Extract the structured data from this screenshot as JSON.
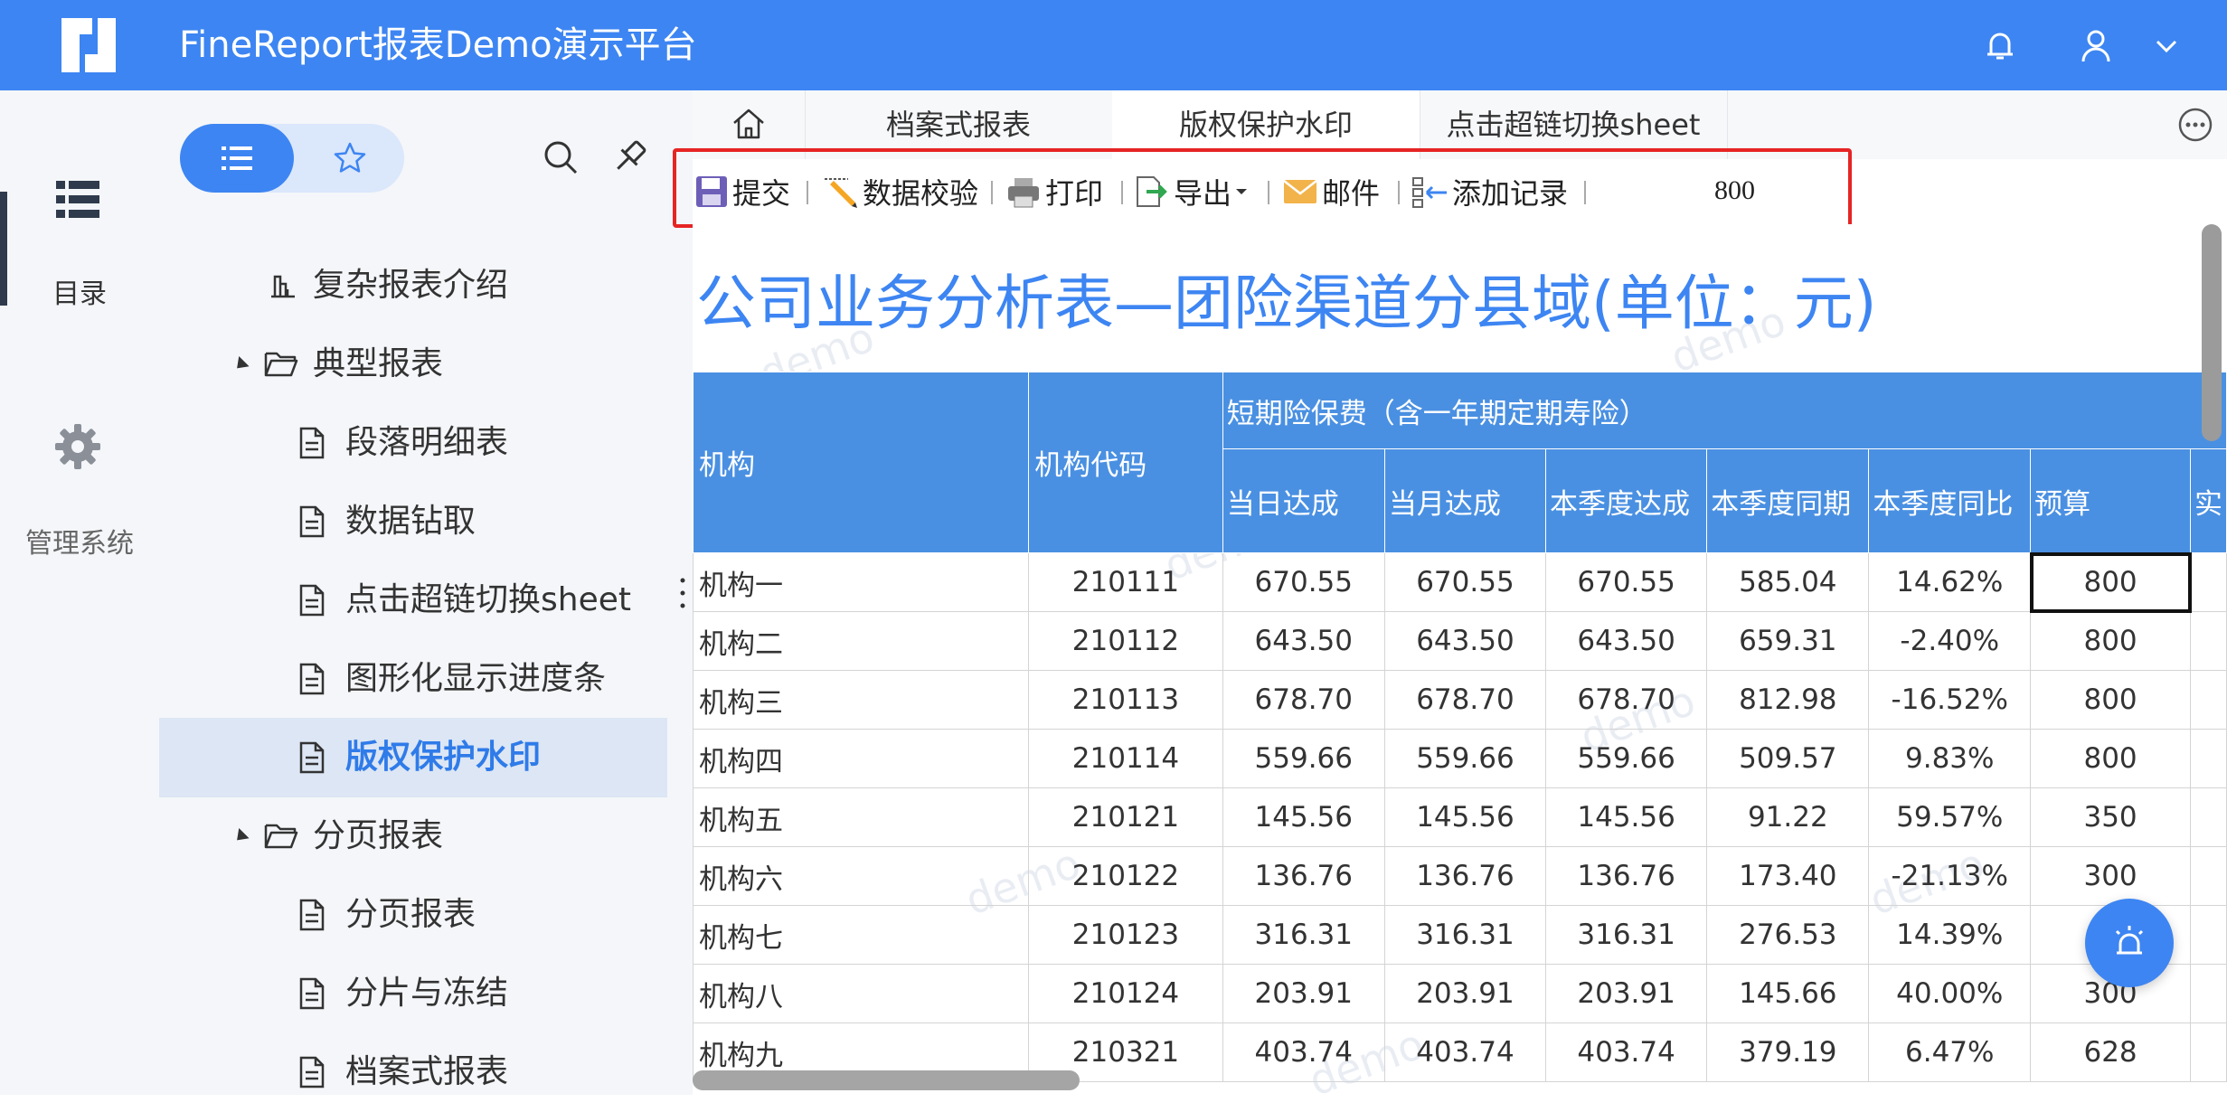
{
  "header": {
    "title": "FineReport报表Demo演示平台"
  },
  "rail": {
    "catalog_label": "目录",
    "admin_label": "管理系统"
  },
  "directory": {
    "items": [
      {
        "label": "复杂报表介绍",
        "level": 0,
        "icon": "chart-icon"
      },
      {
        "label": "典型报表",
        "level": 0,
        "icon": "folder-open-icon",
        "expanded": true
      },
      {
        "label": "段落明细表",
        "level": 1,
        "icon": "document-icon"
      },
      {
        "label": "数据钻取",
        "level": 1,
        "icon": "document-icon"
      },
      {
        "label": "点击超链切换sheet",
        "level": 1,
        "icon": "document-icon"
      },
      {
        "label": "图形化显示进度条",
        "level": 1,
        "icon": "document-icon"
      },
      {
        "label": "版权保护水印",
        "level": 1,
        "icon": "document-icon",
        "selected": true
      },
      {
        "label": "分页报表",
        "level": 0,
        "icon": "folder-open-icon",
        "expanded": true
      },
      {
        "label": "分页报表",
        "level": 1,
        "icon": "document-icon"
      },
      {
        "label": "分片与冻结",
        "level": 1,
        "icon": "document-icon"
      },
      {
        "label": "档案式报表",
        "level": 1,
        "icon": "document-icon"
      }
    ]
  },
  "tabs": [
    {
      "label": "档案式报表"
    },
    {
      "label": "版权保护水印",
      "active": true
    },
    {
      "label": "点击超链切换sheet"
    }
  ],
  "toolbar": {
    "submit": "提交",
    "validate": "数据校验",
    "print": "打印",
    "export": "导出",
    "mail": "邮件",
    "add_record": "添加记录",
    "value": "800"
  },
  "report": {
    "title": "公司业务分析表—团险渠道分县域(单位：元)",
    "watermark": "demo",
    "headers": {
      "org": "机构",
      "code": "机构代码",
      "group": "短期险保费（含一年期定期寿险）",
      "cols": [
        "当日达成",
        "当月达成",
        "本季度达成",
        "本季度同期",
        "本季度同比",
        "预算",
        "实"
      ]
    },
    "rows": [
      [
        "机构一",
        "210111",
        "670.55",
        "670.55",
        "670.55",
        "585.04",
        "14.62%",
        "800"
      ],
      [
        "机构二",
        "210112",
        "643.50",
        "643.50",
        "643.50",
        "659.31",
        "-2.40%",
        "800"
      ],
      [
        "机构三",
        "210113",
        "678.70",
        "678.70",
        "678.70",
        "812.98",
        "-16.52%",
        "800"
      ],
      [
        "机构四",
        "210114",
        "559.66",
        "559.66",
        "559.66",
        "509.57",
        "9.83%",
        "800"
      ],
      [
        "机构五",
        "210121",
        "145.56",
        "145.56",
        "145.56",
        "91.22",
        "59.57%",
        "350"
      ],
      [
        "机构六",
        "210122",
        "136.76",
        "136.76",
        "136.76",
        "173.40",
        "-21.13%",
        "300"
      ],
      [
        "机构七",
        "210123",
        "316.31",
        "316.31",
        "316.31",
        "276.53",
        "14.39%",
        ""
      ],
      [
        "机构八",
        "210124",
        "203.91",
        "203.91",
        "203.91",
        "145.66",
        "40.00%",
        "300"
      ],
      [
        "机构九",
        "210321",
        "403.74",
        "403.74",
        "403.74",
        "379.19",
        "6.47%",
        "628"
      ]
    ]
  },
  "colors": {
    "brand": "#3d85f2",
    "header_cell": "#4a90e2",
    "highlight": "#e62424"
  }
}
